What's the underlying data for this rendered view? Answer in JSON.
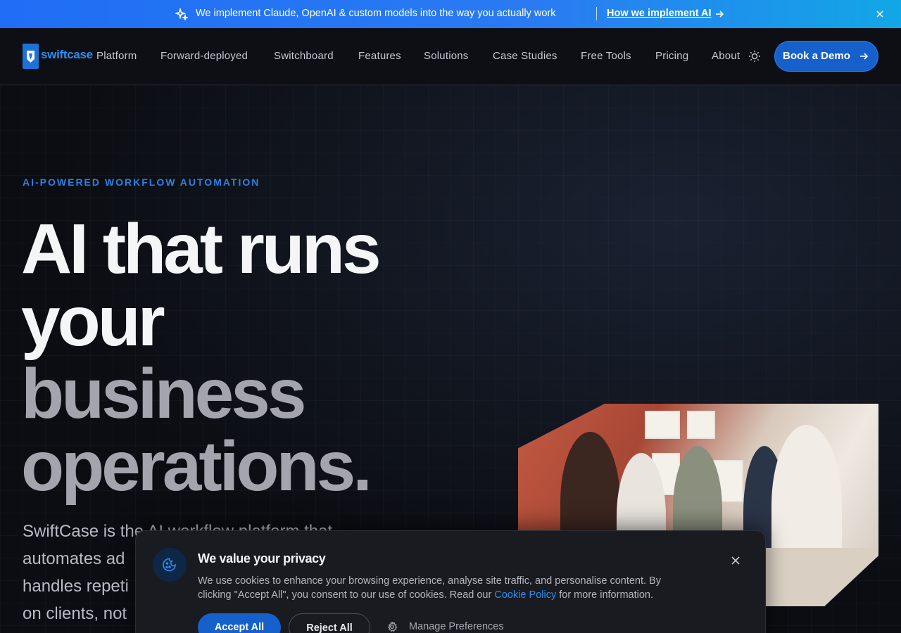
{
  "announcement": {
    "message": "We implement Claude, OpenAI & custom models into the way you actually work",
    "link_label": "How we implement AI",
    "icons": [
      "sparkles-icon",
      "arrow-right-icon",
      "close-icon"
    ]
  },
  "nav": {
    "logo_text": "swiftcase",
    "items": [
      "Platform",
      "Forward-deployed",
      "Switchboard",
      "Features",
      "Solutions",
      "Case Studies",
      "Free Tools",
      "Pricing",
      "About"
    ],
    "theme_icon": "sun-icon",
    "cta_label": "Book a Demo"
  },
  "hero": {
    "eyebrow": "AI-POWERED WORKFLOW AUTOMATION",
    "headline": [
      "AI that runs",
      "your",
      "business",
      "operations."
    ],
    "subtext": "SwiftCase is the AI workflow platform that automates ad",
    "subtext_lines": [
      "SwiftCase is the AI workflow platform that",
      "automates ad",
      "handles repeti",
      "on clients, not"
    ]
  },
  "cookie": {
    "title": "We value your privacy",
    "body_before_link": "We use cookies to enhance your browsing experience, analyse site traffic, and personalise content. By clicking \"Accept All\", you consent to our use of cookies. Read our ",
    "link_label": "Cookie Policy",
    "body_after_link": " for more information.",
    "accept_label": "Accept All",
    "reject_label": "Reject All",
    "manage_label": "Manage Preferences"
  },
  "colors": {
    "accent": "#1660cc",
    "link": "#2d8ef0",
    "background": "#0b0c10"
  }
}
